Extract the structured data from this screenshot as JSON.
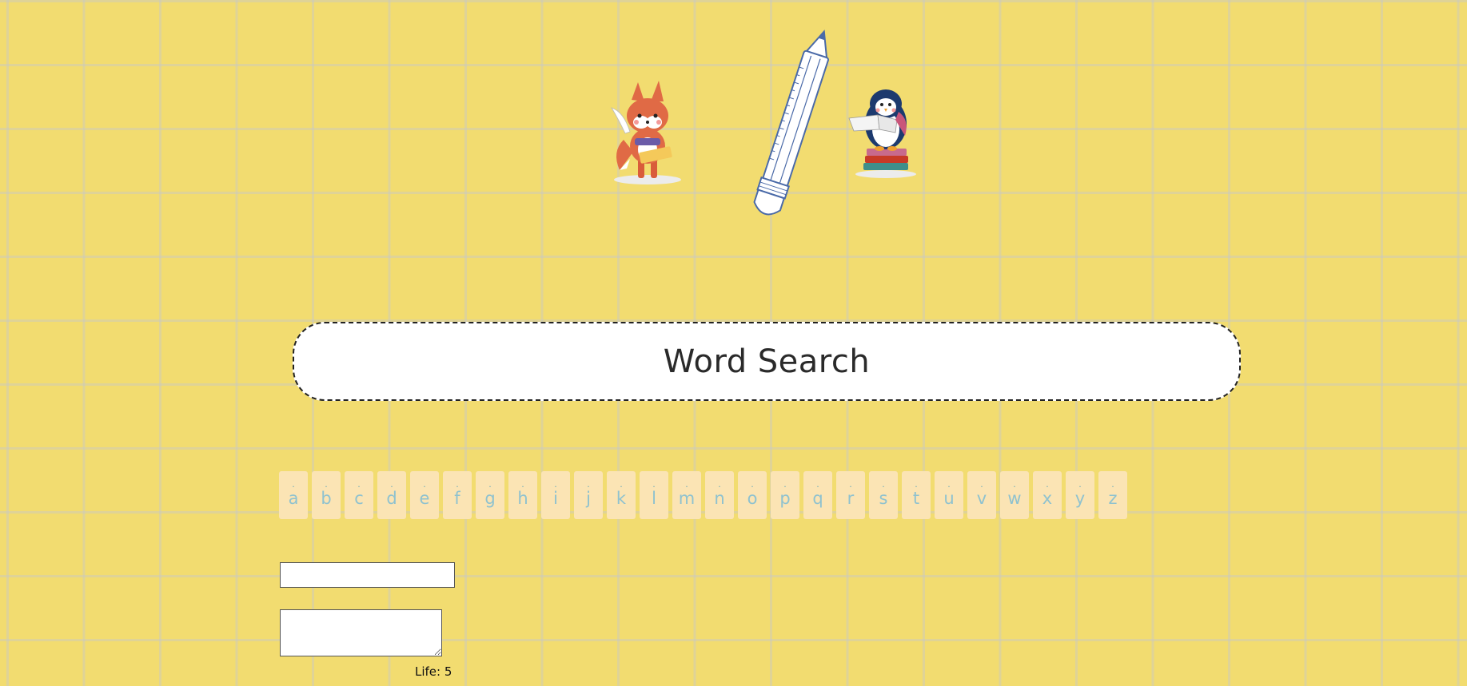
{
  "title": "Word Search",
  "letters": [
    "a",
    "b",
    "c",
    "d",
    "e",
    "f",
    "g",
    "h",
    "i",
    "j",
    "k",
    "l",
    "m",
    "n",
    "o",
    "p",
    "q",
    "r",
    "s",
    "t",
    "u",
    "v",
    "w",
    "x",
    "y",
    "z"
  ],
  "letter_marker": ".",
  "word_input": {
    "value": "",
    "placeholder": ""
  },
  "guess_area": {
    "value": "",
    "placeholder": ""
  },
  "life": {
    "label": "Life:",
    "value": "5"
  },
  "illustrations": [
    "fox-reading",
    "pencil",
    "penguin-reading"
  ],
  "colors": {
    "background": "#f2dc70",
    "letter_tile": "#fbe4b4",
    "letter_text": "#8fc2cf",
    "title_box": "#ffffff"
  }
}
